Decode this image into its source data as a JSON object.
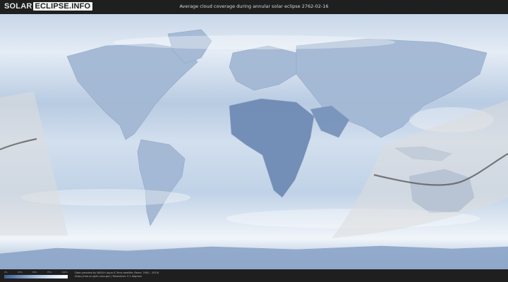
{
  "header": {
    "logo_part1": "SOLAR",
    "logo_part2": "ECLIPSE.INFO",
    "title": "Average cloud coverage during annular solar eclipse 2762-02-16"
  },
  "legend": {
    "ticks": [
      "0%",
      "25%",
      "50%",
      "75%",
      "100%"
    ]
  },
  "footer": {
    "credit_line1": "Data provided by NASA's Aqua & Terra satellite (Years: 2000 - 2019)",
    "credit_line2": "https://neo.sci.gsfc.nasa.gov | Resolution: 0.1 degrees"
  },
  "colors": {
    "cloud_clear": "#3d5f92",
    "cloud_full": "#ffffff",
    "eclipse_band": "#dcdcdc",
    "central_line": "#555555"
  }
}
